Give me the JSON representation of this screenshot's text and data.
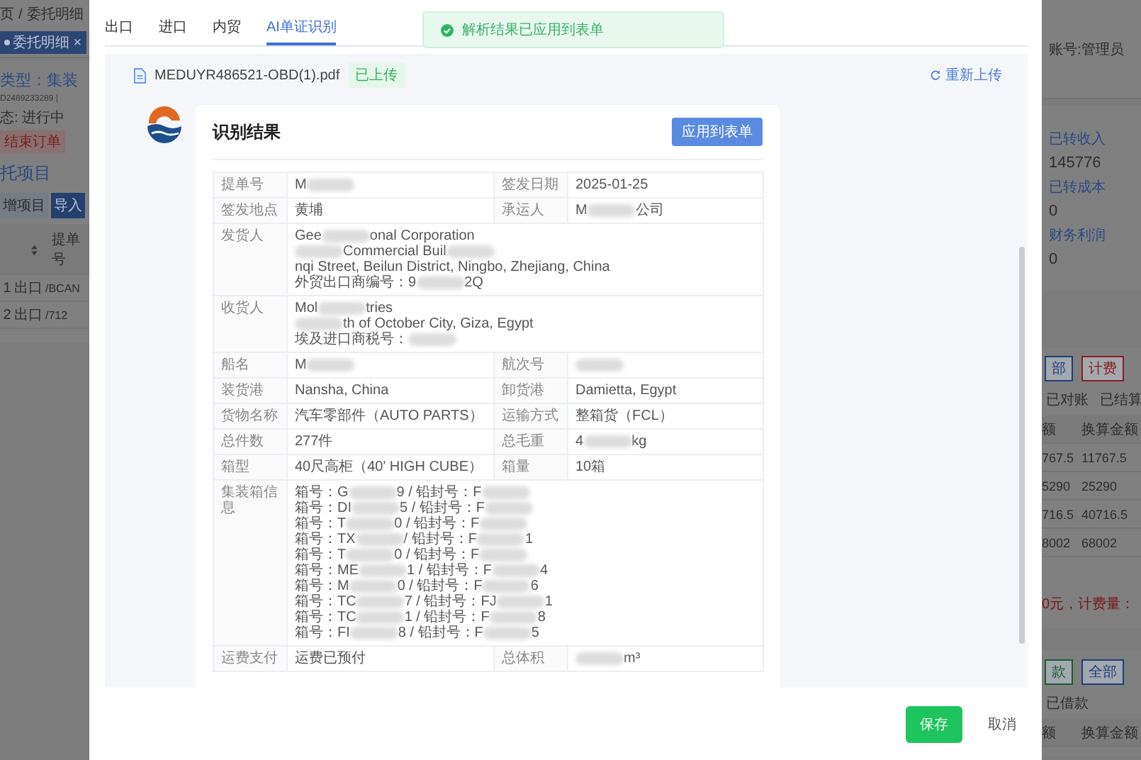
{
  "background": {
    "left": {
      "breadcrumb": [
        "页",
        "/",
        "委托明细"
      ],
      "tab": {
        "label": "委托明细",
        "close": "×"
      },
      "type_label": "类型：集装",
      "order_no": "D2489233289 |",
      "status": "态: 进行中",
      "end_button": "结束订单",
      "section_title": "托项目",
      "buttons": [
        {
          "label": "增项目",
          "kind": "secondary"
        },
        {
          "label": "导入",
          "kind": "primary"
        }
      ],
      "table": {
        "header": "提单号",
        "rows": [
          [
            "1",
            "出口",
            "/BCAN"
          ],
          [
            "2",
            "出口",
            "/712"
          ]
        ]
      }
    },
    "right": {
      "account": "账号:管理员",
      "stats": [
        {
          "label": "已转收入",
          "value": "145776"
        },
        {
          "label": "已转成本",
          "value": "0"
        },
        {
          "label": "财务利润",
          "value": "0"
        }
      ],
      "fee_tags": [
        {
          "label": "部",
          "color": "#1f3f7a"
        },
        {
          "label": "计费",
          "color": "#8a2020"
        }
      ],
      "fee_filters": [
        "已对账",
        "已结算"
      ],
      "fee_columns": [
        "额",
        "换算金额"
      ],
      "fee_rows": [
        [
          "767.5",
          "11767.5"
        ],
        [
          "5290",
          "25290"
        ],
        [
          "716.5",
          "40716.5"
        ],
        [
          "8002",
          "68002"
        ]
      ],
      "fee_summary": "0元，计费量：",
      "loan_tags": [
        {
          "label": "款",
          "color": "#1d5e31"
        },
        {
          "label": "全部",
          "color": "#1f3f7a"
        }
      ],
      "loan_filters": [
        "已借款"
      ],
      "loan_columns": [
        "额",
        "换算金额"
      ]
    }
  },
  "tabs": [
    {
      "label": "出口",
      "selected": false
    },
    {
      "label": "进口",
      "selected": false
    },
    {
      "label": "内贸",
      "selected": false
    },
    {
      "label": "AI单证识别",
      "selected": true
    }
  ],
  "toast": {
    "text": "解析结果已应用到表单"
  },
  "file": {
    "name": "MEDUYR486521-OBD(1).pdf",
    "status": "已上传",
    "reupload": "重新上传"
  },
  "result": {
    "title": "识别结果",
    "apply_button": "应用到表单",
    "rows": [
      {
        "cells": [
          {
            "label": "提单号",
            "lines": [
              [
                "M",
                {
                  "kind": "blur"
                }
              ]
            ]
          },
          {
            "label": "签发日期",
            "lines": [
              [
                "2025-01-25"
              ]
            ]
          }
        ]
      },
      {
        "cells": [
          {
            "label": "签发地点",
            "lines": [
              [
                "黄埔"
              ]
            ]
          },
          {
            "label": "承运人",
            "lines": [
              [
                "M",
                {
                  "kind": "blur"
                },
                "公司"
              ]
            ]
          }
        ]
      },
      {
        "cells": [
          {
            "label": "发货人",
            "lines": [
              [
                "Gee",
                {
                  "kind": "blur"
                },
                "onal Corporation"
              ],
              [
                {
                  "kind": "blur"
                },
                "Commercial Buil",
                {
                  "kind": "blur"
                },
                "nqi Street, Beilun District, Ningbo, Zhejiang, China"
              ],
              [
                "外贸出口商编号：9",
                {
                  "kind": "blur"
                },
                "2Q"
              ]
            ]
          }
        ]
      },
      {
        "cells": [
          {
            "label": "收货人",
            "lines": [
              [
                "Mol",
                {
                  "kind": "blur"
                },
                "tries"
              ],
              [
                {
                  "kind": "blur"
                },
                "th of October City, Giza, Egypt"
              ],
              [
                "埃及进口商税号：",
                {
                  "kind": "blur"
                }
              ]
            ]
          }
        ]
      },
      {
        "cells": [
          {
            "label": "船名",
            "lines": [
              [
                "M",
                {
                  "kind": "blur"
                }
              ]
            ]
          },
          {
            "label": "航次号",
            "lines": [
              [
                {
                  "kind": "blur"
                }
              ]
            ]
          }
        ]
      },
      {
        "cells": [
          {
            "label": "装货港",
            "lines": [
              [
                "Nansha, China"
              ]
            ]
          },
          {
            "label": "卸货港",
            "lines": [
              [
                "Damietta, Egypt"
              ]
            ]
          }
        ]
      },
      {
        "cells": [
          {
            "label": "货物名称",
            "lines": [
              [
                "汽车零部件（AUTO PARTS）"
              ]
            ]
          },
          {
            "label": "运输方式",
            "lines": [
              [
                "整箱货（FCL）"
              ]
            ]
          }
        ]
      },
      {
        "cells": [
          {
            "label": "总件数",
            "lines": [
              [
                "277件"
              ]
            ]
          },
          {
            "label": "总毛重",
            "lines": [
              [
                "4",
                {
                  "kind": "blur"
                },
                "kg"
              ]
            ]
          }
        ]
      },
      {
        "cells": [
          {
            "label": "箱型",
            "lines": [
              [
                "40尺高柜（40' HIGH CUBE）"
              ]
            ]
          },
          {
            "label": "箱量",
            "lines": [
              [
                "10箱"
              ]
            ]
          }
        ]
      },
      {
        "cells": [
          {
            "label": "集装箱信息",
            "lines": [
              [
                "箱号：G",
                {
                  "kind": "blur"
                },
                "9 / 铅封号：F",
                {
                  "kind": "blur"
                }
              ],
              [
                "箱号：DI",
                {
                  "kind": "blur"
                },
                "5 / 铅封号：F",
                {
                  "kind": "blur"
                }
              ],
              [
                "箱号：T",
                {
                  "kind": "blur"
                },
                "0 / 铅封号：F",
                {
                  "kind": "blur"
                }
              ],
              [
                "箱号：TX",
                {
                  "kind": "blur"
                },
                " / 铅封号：F",
                {
                  "kind": "blur"
                },
                "1"
              ],
              [
                "箱号：T",
                {
                  "kind": "blur"
                },
                "0 / 铅封号：F",
                {
                  "kind": "blur"
                }
              ],
              [
                "箱号：ME",
                {
                  "kind": "blur"
                },
                "1 / 铅封号：F",
                {
                  "kind": "blur"
                },
                "4"
              ],
              [
                "箱号：M",
                {
                  "kind": "blur"
                },
                "0 / 铅封号：F",
                {
                  "kind": "blur"
                },
                "6"
              ],
              [
                "箱号：TC",
                {
                  "kind": "blur"
                },
                "7 / 铅封号：FJ",
                {
                  "kind": "blur"
                },
                "1"
              ],
              [
                "箱号：TC",
                {
                  "kind": "blur"
                },
                "1 / 铅封号：F",
                {
                  "kind": "blur"
                },
                "8"
              ],
              [
                "箱号：FI",
                {
                  "kind": "blur"
                },
                "8 / 铅封号：F",
                {
                  "kind": "blur"
                },
                "5"
              ]
            ]
          }
        ]
      },
      {
        "cells": [
          {
            "label": "运费支付",
            "lines": [
              [
                "运费已预付"
              ]
            ]
          },
          {
            "label": "总体积",
            "lines": [
              [
                {
                  "kind": "blur"
                },
                "m³"
              ]
            ]
          }
        ]
      }
    ]
  },
  "footer": {
    "buttons": [
      {
        "label": "保存",
        "kind": "primary"
      },
      {
        "label": "取消",
        "kind": "text"
      }
    ]
  }
}
